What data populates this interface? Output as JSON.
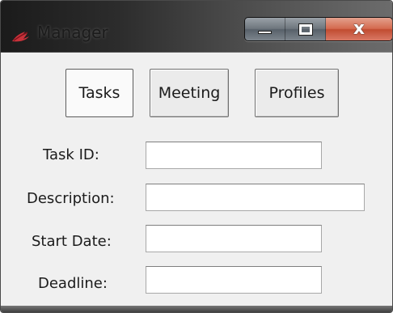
{
  "window": {
    "title": "Manager",
    "app_icon": "red-tk-feather-icon",
    "controls": [
      {
        "name": "minimize",
        "icon": "minimize-icon"
      },
      {
        "name": "maximize",
        "icon": "maximize-icon"
      },
      {
        "name": "close",
        "icon": "close-icon",
        "glyph": "x"
      }
    ]
  },
  "tabs": [
    {
      "label": "Tasks",
      "active": true
    },
    {
      "label": "Meeting",
      "active": false
    },
    {
      "label": "Profiles",
      "active": false
    }
  ],
  "form": {
    "task_id_label": "Task ID:",
    "task_id_value": "",
    "description_label": "Description:",
    "description_value": "",
    "start_date_label": "Start Date:",
    "start_date_value": "",
    "deadline_label": "Deadline:",
    "deadline_value": ""
  },
  "colors": {
    "window_background": "#f0f0f0",
    "titlebar_dark": "#1b1b1b",
    "close_button": "#c14c31",
    "input_background": "#ffffff"
  }
}
